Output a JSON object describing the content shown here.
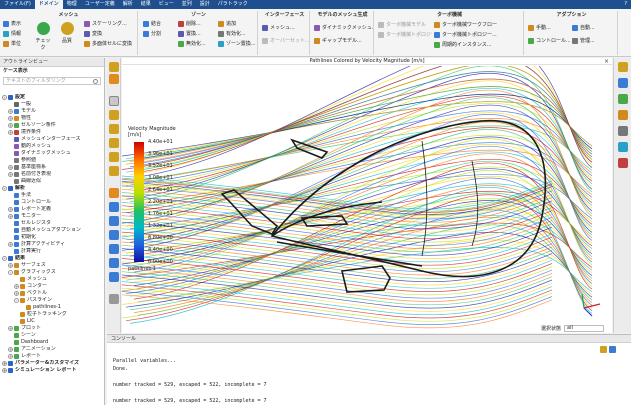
{
  "menu": {
    "tabs": [
      "ファイル(F)",
      "ドメイン",
      "物理",
      "ユーザー定義",
      "解析",
      "結果",
      "ビュー",
      "並列",
      "設計",
      "パラトラック"
    ],
    "active": 1,
    "help": "?"
  },
  "ribbon": {
    "mesh": {
      "title": "メッシュ",
      "display": "表示",
      "info": "情報",
      "units": "単位",
      "check": "チェック",
      "quality": "品質",
      "scaling": "スケーリング...",
      "transform": "変換",
      "convert": "多面体セルに変換"
    },
    "zone": {
      "title": "ゾーン",
      "combine": "結合",
      "separate": "分割",
      "delete": "削除...",
      "replace_mesh": "置換...",
      "activate": "無効化...",
      "append": "追加",
      "deactivate": "有効化...",
      "replace_zone": "ゾーン置換..."
    },
    "interface": {
      "title": "インターフェース",
      "mesh": "メッシュ...",
      "overset": "オーバーセット..."
    },
    "mesh_models": {
      "title": "モデルのメッシュ生成",
      "dynamic": "ダイナミックメッシュ...",
      "gap": "ギャップモデル..."
    },
    "turbo": {
      "title": "ターボ機械",
      "turbo_model": "ターボ機械モデル",
      "topology": "ターボ機械トポロジー",
      "workflow": "ターボ機械ワークフロー",
      "create": "ターボ機械トポロジー...",
      "periodic": "周期的インスタンス..."
    },
    "adapt": {
      "title": "アダプション",
      "manual": "手動...",
      "auto": "自動...",
      "control": "コントロール...",
      "manage": "管理..."
    }
  },
  "outline": {
    "title": "アウトラインビュー",
    "tree_title": "ケース表示",
    "filter_placeholder": "テキストのフィルタリング",
    "items": [
      {
        "label": "設定",
        "level": 0,
        "exp": "-",
        "bold": true,
        "color": "#2a64c8"
      },
      {
        "label": "一般",
        "level": 1,
        "exp": "",
        "color": "#666666"
      },
      {
        "label": "モデル",
        "level": 1,
        "exp": "+",
        "color": "#3a7bd5"
      },
      {
        "label": "物性",
        "level": 1,
        "exp": "+",
        "color": "#d08a20"
      },
      {
        "label": "セルゾーン条件",
        "level": 1,
        "exp": "+",
        "color": "#4aa84a"
      },
      {
        "label": "境界条件",
        "level": 1,
        "exp": "+",
        "color": "#c04040"
      },
      {
        "label": "メッシュインターフェース",
        "level": 1,
        "exp": "",
        "color": "#5a5ab0"
      },
      {
        "label": "動的メッシュ",
        "level": 1,
        "exp": "",
        "color": "#8a5ab0"
      },
      {
        "label": "ダイナミックメッシュ",
        "level": 1,
        "exp": "",
        "color": "#8a5ab0"
      },
      {
        "label": "参照値",
        "level": 1,
        "exp": "",
        "color": "#777777"
      },
      {
        "label": "基準座標系",
        "level": 1,
        "exp": "+",
        "color": "#777777"
      },
      {
        "label": "名前付き表現",
        "level": 1,
        "exp": "+",
        "color": "#777777"
      },
      {
        "label": "曲線近似",
        "level": 1,
        "exp": "",
        "color": "#777777"
      },
      {
        "label": "解析",
        "level": 0,
        "exp": "-",
        "bold": true,
        "color": "#2a64c8"
      },
      {
        "label": "手法",
        "level": 1,
        "exp": "",
        "color": "#3a7bd5"
      },
      {
        "label": "コントロール",
        "level": 1,
        "exp": "",
        "color": "#3a7bd5"
      },
      {
        "label": "レポート定義",
        "level": 1,
        "exp": "+",
        "color": "#3a7bd5"
      },
      {
        "label": "モニター",
        "level": 1,
        "exp": "+",
        "color": "#3a7bd5"
      },
      {
        "label": "セルレジスタ",
        "level": 1,
        "exp": "",
        "color": "#3a7bd5"
      },
      {
        "label": "自動メッシュアダプション",
        "level": 1,
        "exp": "",
        "color": "#3a7bd5"
      },
      {
        "label": "初期化",
        "level": 1,
        "exp": "",
        "color": "#3a7bd5"
      },
      {
        "label": "計算アクティビティ",
        "level": 1,
        "exp": "+",
        "color": "#3a7bd5"
      },
      {
        "label": "計算実行",
        "level": 1,
        "exp": "",
        "color": "#3a7bd5"
      },
      {
        "label": "結果",
        "level": 0,
        "exp": "-",
        "bold": true,
        "color": "#2a64c8"
      },
      {
        "label": "サーフェス",
        "level": 1,
        "exp": "+",
        "color": "#d08a20"
      },
      {
        "label": "グラフィックス",
        "level": 1,
        "exp": "-",
        "color": "#d08a20"
      },
      {
        "label": "メッシュ",
        "level": 2,
        "exp": "",
        "color": "#d08a20"
      },
      {
        "label": "コンター",
        "level": 2,
        "exp": "+",
        "color": "#d08a20"
      },
      {
        "label": "ベクトル",
        "level": 2,
        "exp": "+",
        "color": "#d08a20"
      },
      {
        "label": "パスライン",
        "level": 2,
        "exp": "-",
        "color": "#d08a20"
      },
      {
        "label": "pathlines-1",
        "level": 3,
        "exp": "",
        "color": "#d08a20"
      },
      {
        "label": "粒子トラッキング",
        "level": 2,
        "exp": "",
        "color": "#d08a20"
      },
      {
        "label": "LIC",
        "level": 2,
        "exp": "",
        "color": "#d08a20"
      },
      {
        "label": "プロット",
        "level": 1,
        "exp": "+",
        "color": "#4aa84a"
      },
      {
        "label": "シーン",
        "level": 1,
        "exp": "",
        "color": "#4aa84a"
      },
      {
        "label": "Dashboard",
        "level": 1,
        "exp": "",
        "color": "#4aa84a"
      },
      {
        "label": "アニメーション",
        "level": 1,
        "exp": "+",
        "color": "#4aa84a"
      },
      {
        "label": "レポート",
        "level": 1,
        "exp": "+",
        "color": "#4aa84a"
      },
      {
        "label": "パラメーター&カスタマイズ",
        "level": 0,
        "exp": "+",
        "bold": true,
        "color": "#2a64c8"
      },
      {
        "label": "シミュレーション レポート",
        "level": 0,
        "exp": "+",
        "bold": true,
        "color": "#2a64c8"
      }
    ]
  },
  "viewport": {
    "title": "Pathlines Colored by Velocity Magnitude [m/s]",
    "close": "×",
    "legend_title": "Velocity Magnitude",
    "legend_unit": "[m/s]",
    "legend_ticks": [
      "4.40e+01",
      "3.96e+01",
      "3.52e+01",
      "3.08e+01",
      "2.64e+01",
      "2.20e+01",
      "1.76e+01",
      "1.32e+01",
      "8.80e+00",
      "4.40e+00",
      "0.00e+00"
    ],
    "legend_name": "pathlines-1",
    "view_label": "選択状態",
    "view_value": "all"
  },
  "console": {
    "tab": "コンソール",
    "lines": [
      "",
      "Parallel variables...",
      "Done.",
      "",
      "number tracked = 529, escaped = 522, incomplete = 7",
      "",
      "number tracked = 529, escaped = 522, incomplete = 7"
    ]
  },
  "colors": {
    "menubar": "#1f4f8f",
    "ribbon": "#f4f4f4",
    "hull": "#1a1a1a"
  }
}
